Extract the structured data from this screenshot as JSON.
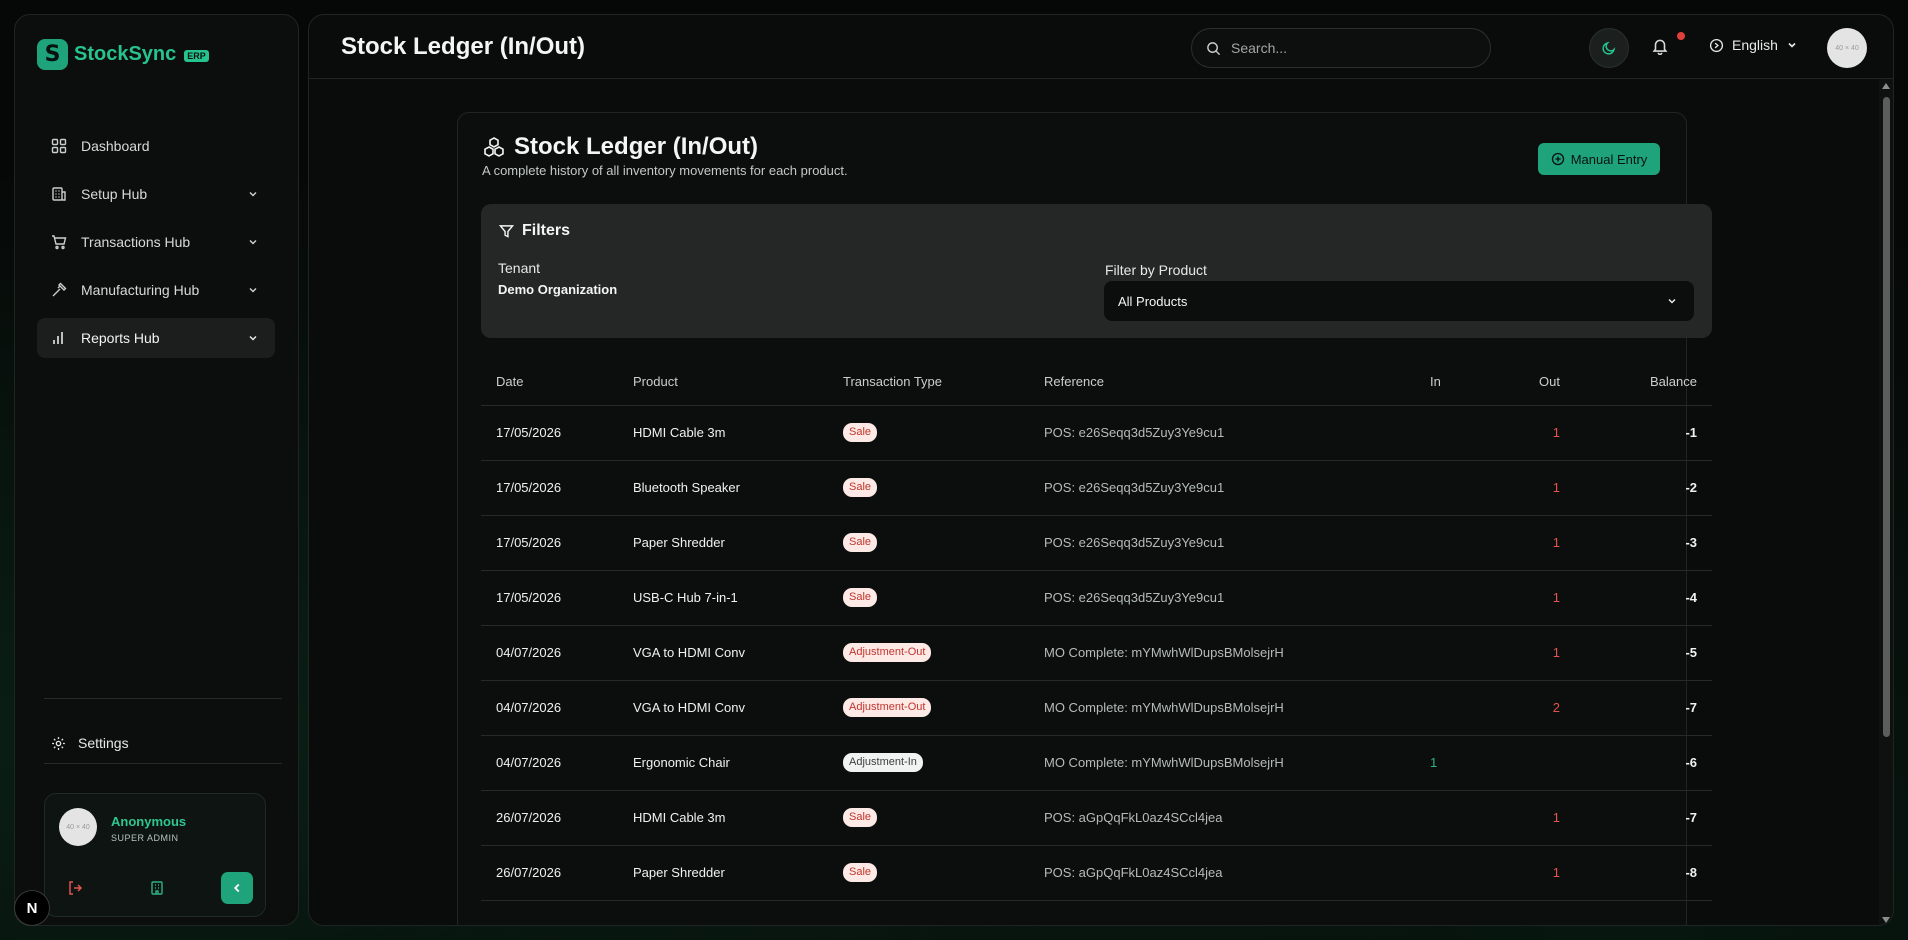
{
  "app": {
    "brand": "StockSync",
    "brand_badge": "ERP",
    "logo_letter": "S"
  },
  "sidebar": {
    "items": [
      {
        "label": "Dashboard",
        "icon": "dashboard-icon"
      },
      {
        "label": "Setup Hub",
        "icon": "building-icon"
      },
      {
        "label": "Transactions Hub",
        "icon": "cart-icon"
      },
      {
        "label": "Manufacturing Hub",
        "icon": "hammer-icon"
      },
      {
        "label": "Reports Hub",
        "icon": "bar-chart-icon"
      }
    ],
    "settings_label": "Settings"
  },
  "user": {
    "name": "Anonymous",
    "role": "SUPER ADMIN",
    "avatar_text": "40 × 40"
  },
  "header": {
    "title": "Stock Ledger (In/Out)",
    "search_placeholder": "Search...",
    "language": "English",
    "avatar_text": "40 × 40"
  },
  "card": {
    "title": "Stock Ledger (In/Out)",
    "subtitle": "A complete history of all inventory movements for each product.",
    "manual_entry_label": "Manual Entry"
  },
  "filters": {
    "title": "Filters",
    "tenant_label": "Tenant",
    "tenant_value": "Demo Organization",
    "product_label": "Filter by Product",
    "product_selected": "All Products"
  },
  "table": {
    "columns": [
      "Date",
      "Product",
      "Transaction Type",
      "Reference",
      "In",
      "Out",
      "Balance"
    ],
    "rows": [
      {
        "date": "17/05/2026",
        "product": "HDMI Cable 3m",
        "type": "Sale",
        "type_kind": "sale",
        "ref": "POS: e26Seqq3d5Zuy3Ye9cu1",
        "in": "",
        "out": "1",
        "balance": "-1"
      },
      {
        "date": "17/05/2026",
        "product": "Bluetooth Speaker",
        "type": "Sale",
        "type_kind": "sale",
        "ref": "POS: e26Seqq3d5Zuy3Ye9cu1",
        "in": "",
        "out": "1",
        "balance": "-2"
      },
      {
        "date": "17/05/2026",
        "product": "Paper Shredder",
        "type": "Sale",
        "type_kind": "sale",
        "ref": "POS: e26Seqq3d5Zuy3Ye9cu1",
        "in": "",
        "out": "1",
        "balance": "-3"
      },
      {
        "date": "17/05/2026",
        "product": "USB-C Hub 7-in-1",
        "type": "Sale",
        "type_kind": "sale",
        "ref": "POS: e26Seqq3d5Zuy3Ye9cu1",
        "in": "",
        "out": "1",
        "balance": "-4"
      },
      {
        "date": "04/07/2026",
        "product": "VGA to HDMI Conv",
        "type": "Adjustment-Out",
        "type_kind": "adj-out",
        "ref": "MO Complete: mYMwhWlDupsBMolsejrH",
        "in": "",
        "out": "1",
        "balance": "-5"
      },
      {
        "date": "04/07/2026",
        "product": "VGA to HDMI Conv",
        "type": "Adjustment-Out",
        "type_kind": "adj-out",
        "ref": "MO Complete: mYMwhWlDupsBMolsejrH",
        "in": "",
        "out": "2",
        "balance": "-7"
      },
      {
        "date": "04/07/2026",
        "product": "Ergonomic Chair",
        "type": "Adjustment-In",
        "type_kind": "adj-in",
        "ref": "MO Complete: mYMwhWlDupsBMolsejrH",
        "in": "1",
        "out": "",
        "balance": "-6"
      },
      {
        "date": "26/07/2026",
        "product": "HDMI Cable 3m",
        "type": "Sale",
        "type_kind": "sale",
        "ref": "POS: aGpQqFkL0az4SCcl4jea",
        "in": "",
        "out": "1",
        "balance": "-7"
      },
      {
        "date": "26/07/2026",
        "product": "Paper Shredder",
        "type": "Sale",
        "type_kind": "sale",
        "ref": "POS: aGpQqFkL0az4SCcl4jea",
        "in": "",
        "out": "1",
        "balance": "-8"
      }
    ]
  },
  "colors": {
    "accent": "#1ea37a",
    "in_value": "#2fb285",
    "out_value": "#e2554d"
  }
}
